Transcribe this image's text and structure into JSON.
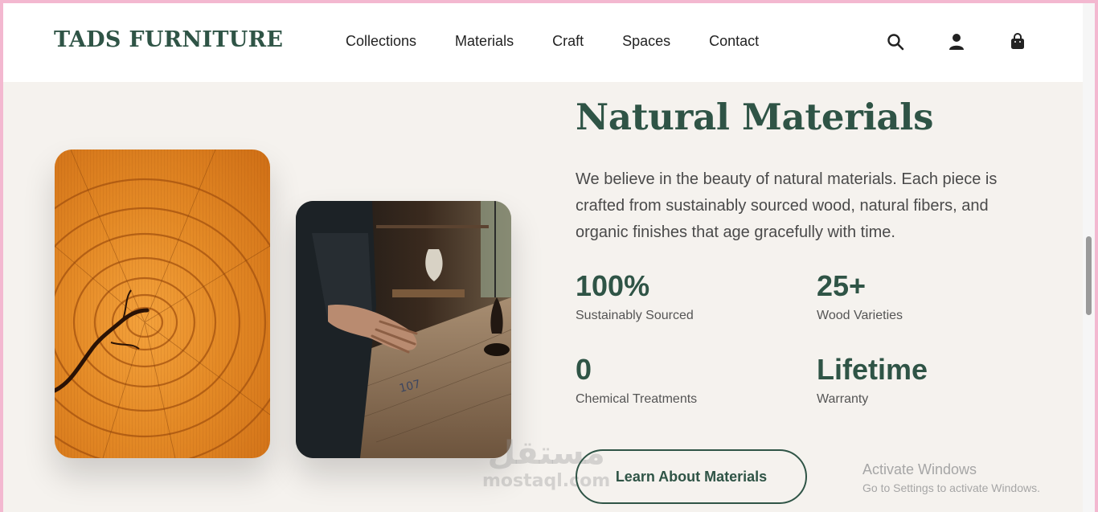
{
  "brand": {
    "logo": "TADS FURNITURE"
  },
  "nav": [
    "Collections",
    "Materials",
    "Craft",
    "Spaces",
    "Contact"
  ],
  "header_icons": [
    "search-icon",
    "account-icon",
    "shopping-bag-icon"
  ],
  "section": {
    "title": "Natural Materials",
    "description": "We believe in the beauty of natural materials. Each piece is crafted from sustainably sourced wood, natural fibers, and organic finishes that age gracefully with time.",
    "stats": [
      {
        "value": "100%",
        "label": "Sustainably Sourced"
      },
      {
        "value": "25+",
        "label": "Wood Varieties"
      },
      {
        "value": "0",
        "label": "Chemical Treatments"
      },
      {
        "value": "Lifetime",
        "label": "Warranty"
      }
    ],
    "cta_label": "Learn About Materials"
  },
  "images": {
    "left": "wood-grain-image",
    "right": "craftsman-workshop-image",
    "workbench_marking": "107"
  },
  "watermark": {
    "arabic": "مستقل",
    "latin": "mostaql.com"
  },
  "os_notice": {
    "title": "Activate Windows",
    "subtitle": "Go to Settings to activate Windows."
  },
  "colors": {
    "brand_green": "#2f5446",
    "background": "#f5f2ee",
    "header_bg": "#ffffff",
    "wood_orange": "#e08a2a"
  }
}
